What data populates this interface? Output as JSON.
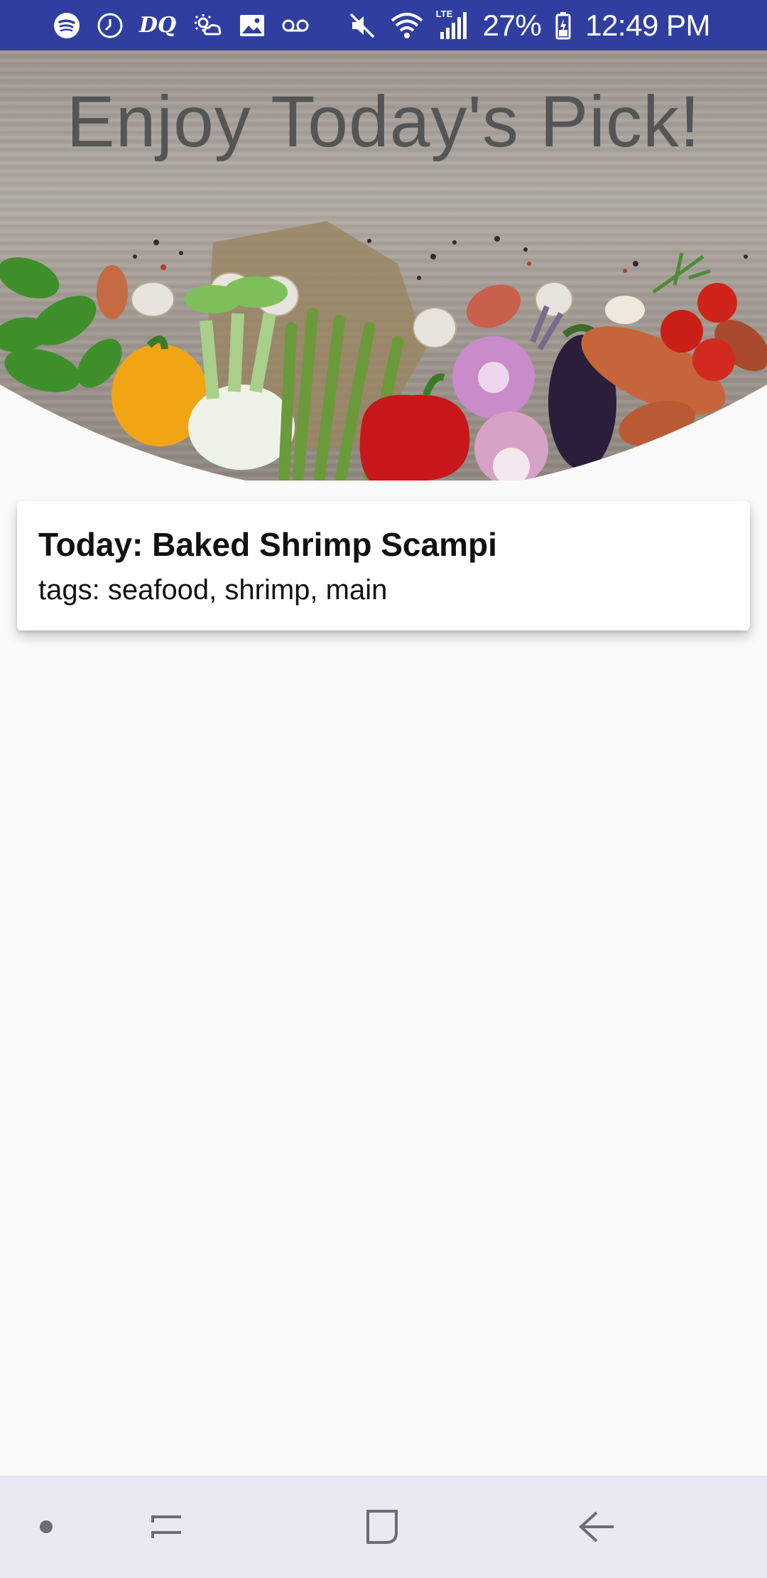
{
  "status_bar": {
    "left_icons": [
      "spotify-icon",
      "clock-icon",
      "dq-icon",
      "weather-icon",
      "image-icon",
      "voicemail-icon"
    ],
    "dq_text": "DQ",
    "right_icons": [
      "mute-icon",
      "wifi-icon",
      "lte-signal-icon",
      "battery-icon"
    ],
    "lte_label": "LTE",
    "battery": "27%",
    "time": "12:49 PM",
    "background_color": "#303f9f"
  },
  "header": {
    "title": "Enjoy Today's Pick!"
  },
  "pick_card": {
    "title": "Today: Baked Shrimp Scampi",
    "tags": "tags: seafood, shrimp, main"
  },
  "nav_bar": {
    "items": [
      "dot-icon",
      "recents-icon",
      "home-icon",
      "back-icon"
    ]
  }
}
